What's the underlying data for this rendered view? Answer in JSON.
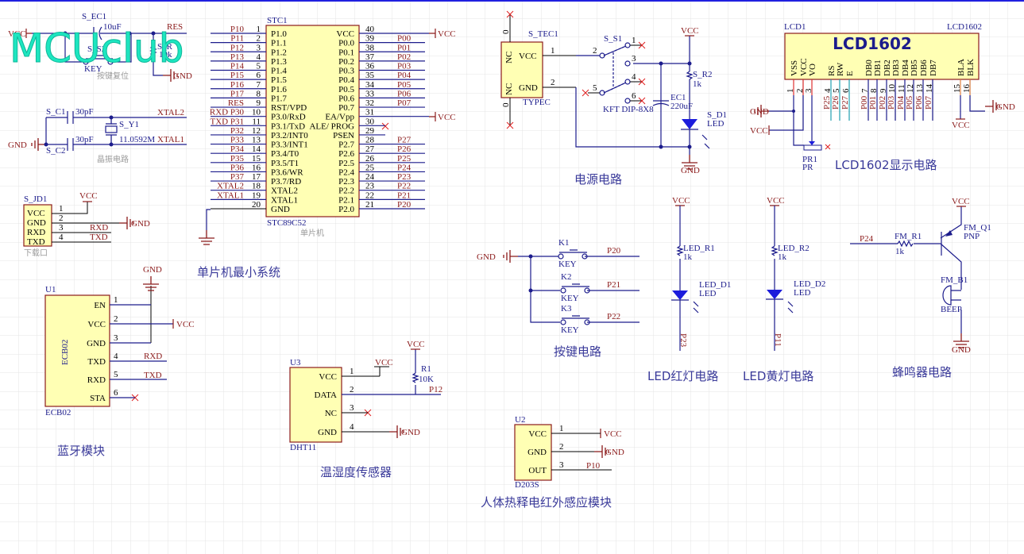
{
  "logo": "MCUclub",
  "nets": {
    "vcc": "VCC",
    "gnd": "GND",
    "res": "RES",
    "xtal1": "XTAL1",
    "xtal2": "XTAL2",
    "rxd": "RXD",
    "txd": "TXD",
    "p10": "P10",
    "p11": "P11",
    "p12": "P12",
    "p20": "P20",
    "p21": "P21",
    "p22": "P22",
    "p23": "P23",
    "p24": "P24"
  },
  "reset": {
    "cap": "S_EC1",
    "cap_value": "10uF",
    "switch": "S_S2",
    "switch_value": "KEY",
    "res": "S_R",
    "res_value": "10k",
    "note": "按键复位"
  },
  "crystal": {
    "c1": "S_C1",
    "c2": "S_C2",
    "c_value": "30pF",
    "xtal": "S_Y1",
    "xtal_value": "11.0592M",
    "note": "晶振电路"
  },
  "header": {
    "ref": "S_JD1",
    "pins": [
      {
        "num": "1",
        "name": "VCC"
      },
      {
        "num": "2",
        "name": "GND"
      },
      {
        "num": "3",
        "name": "RXD"
      },
      {
        "num": "4",
        "name": "TXD"
      }
    ],
    "note": "下载口"
  },
  "mcu": {
    "ref": "STC1",
    "part": "STC89C52",
    "note": "单片机",
    "title": "单片机最小系统",
    "left_pins": [
      {
        "num": "1",
        "name": "P1.0",
        "net": "P10"
      },
      {
        "num": "2",
        "name": "P1.1",
        "net": "P11"
      },
      {
        "num": "3",
        "name": "P1.2",
        "net": "P12"
      },
      {
        "num": "4",
        "name": "P1.3",
        "net": "P13"
      },
      {
        "num": "5",
        "name": "P1.4",
        "net": "P14"
      },
      {
        "num": "6",
        "name": "P1.5",
        "net": "P15"
      },
      {
        "num": "7",
        "name": "P1.6",
        "net": "P16"
      },
      {
        "num": "8",
        "name": "P1.7",
        "net": "P17"
      },
      {
        "num": "9",
        "name": "RST/VPD",
        "net": "RES"
      },
      {
        "num": "10",
        "name": "P3.0/RxD",
        "net": "RXD P30"
      },
      {
        "num": "11",
        "name": "P3.1/TxD",
        "net": "TXD P31"
      },
      {
        "num": "12",
        "name": "P3.2/INT0",
        "net": "P32"
      },
      {
        "num": "13",
        "name": "P3.3/INT1",
        "net": "P33"
      },
      {
        "num": "14",
        "name": "P3.4/T0",
        "net": "P34"
      },
      {
        "num": "15",
        "name": "P3.5/T1",
        "net": "P35"
      },
      {
        "num": "16",
        "name": "P3.6/WR",
        "net": "P36"
      },
      {
        "num": "17",
        "name": "P3.7/RD",
        "net": "P37"
      },
      {
        "num": "18",
        "name": "XTAL2",
        "net": "XTAL2"
      },
      {
        "num": "19",
        "name": "XTAL1",
        "net": "XTAL1"
      },
      {
        "num": "20",
        "name": "GND",
        "net": ""
      }
    ],
    "right_pins": [
      {
        "num": "40",
        "name": "VCC",
        "net": "VCC"
      },
      {
        "num": "39",
        "name": "P0.0",
        "net": "P00"
      },
      {
        "num": "38",
        "name": "P0.1",
        "net": "P01"
      },
      {
        "num": "37",
        "name": "P0.2",
        "net": "P02"
      },
      {
        "num": "36",
        "name": "P0.3",
        "net": "P03"
      },
      {
        "num": "35",
        "name": "P0.4",
        "net": "P04"
      },
      {
        "num": "34",
        "name": "P0.5",
        "net": "P05"
      },
      {
        "num": "33",
        "name": "P0.6",
        "net": "P06"
      },
      {
        "num": "32",
        "name": "P0.7",
        "net": "P07"
      },
      {
        "num": "31",
        "name": "EA/Vpp",
        "net": "VCC"
      },
      {
        "num": "30",
        "name": "ALE/ PROG",
        "net": ""
      },
      {
        "num": "29",
        "name": "PSEN",
        "net": ""
      },
      {
        "num": "28",
        "name": "P2.7",
        "net": "P27"
      },
      {
        "num": "27",
        "name": "P2.6",
        "net": "P26"
      },
      {
        "num": "26",
        "name": "P2.5",
        "net": "P25"
      },
      {
        "num": "25",
        "name": "P2.4",
        "net": "P24"
      },
      {
        "num": "24",
        "name": "P2.3",
        "net": "P23"
      },
      {
        "num": "23",
        "name": "P2.2",
        "net": "P22"
      },
      {
        "num": "22",
        "name": "P2.1",
        "net": "P21"
      },
      {
        "num": "21",
        "name": "P2.0",
        "net": "P20"
      }
    ]
  },
  "bluetooth": {
    "ref": "U1",
    "part": "ECB02",
    "body_label": "ECB02",
    "title": "蓝牙模块",
    "pins": [
      {
        "num": "1",
        "name": "EN"
      },
      {
        "num": "2",
        "name": "VCC"
      },
      {
        "num": "3",
        "name": "GND"
      },
      {
        "num": "4",
        "name": "TXD"
      },
      {
        "num": "5",
        "name": "RXD"
      },
      {
        "num": "6",
        "name": "STA"
      }
    ]
  },
  "dht": {
    "ref": "U3",
    "part": "DHT11",
    "res": "R1",
    "res_value": "10K",
    "title": "温湿度传感器",
    "pins": [
      {
        "num": "1",
        "name": "VCC"
      },
      {
        "num": "2",
        "name": "DATA"
      },
      {
        "num": "3",
        "name": "NC"
      },
      {
        "num": "4",
        "name": "GND"
      }
    ]
  },
  "pir": {
    "ref": "U2",
    "part": "D203S",
    "title": "人体热释电红外感应模块",
    "pins": [
      {
        "num": "1",
        "name": "VCC"
      },
      {
        "num": "2",
        "name": "GND"
      },
      {
        "num": "3",
        "name": "OUT"
      }
    ]
  },
  "power": {
    "ref": "S_TEC1",
    "part": "TYPEC",
    "nc": "NC",
    "zero": "0",
    "p_vcc": "VCC",
    "p_gnd": "GND",
    "pin1": "1",
    "pin2": "2",
    "switch": "S_S1",
    "switch_part": "KFT DIP-8X8",
    "sw_pins": [
      "1",
      "2",
      "3",
      "4",
      "5",
      "6"
    ],
    "cap": "EC1",
    "cap_value": "220uF",
    "res": "S_R2",
    "res_value": "1k",
    "led": "S_D1",
    "led_value": "LED",
    "title": "电源电路"
  },
  "lcd": {
    "ref": "LCD1",
    "part": "LCD1602",
    "body_label": "LCD1602",
    "title": "LCD1602显示电路",
    "pot": "PR1",
    "pot_value": "PR",
    "pins": [
      {
        "num": "1",
        "name": "VSS",
        "net": ""
      },
      {
        "num": "2",
        "name": "VCC",
        "net": ""
      },
      {
        "num": "3",
        "name": "VO",
        "net": ""
      },
      {
        "num": "4",
        "name": "RS",
        "net": "P25"
      },
      {
        "num": "5",
        "name": "RW",
        "net": "P26"
      },
      {
        "num": "6",
        "name": "E",
        "net": "P27"
      },
      {
        "num": "7",
        "name": "DB0",
        "net": "P00"
      },
      {
        "num": "8",
        "name": "DB1",
        "net": "P01"
      },
      {
        "num": "9",
        "name": "DB2",
        "net": "P02"
      },
      {
        "num": "10",
        "name": "DB3",
        "net": "P03"
      },
      {
        "num": "11",
        "name": "DB4",
        "net": "P04"
      },
      {
        "num": "12",
        "name": "DB5",
        "net": "P05"
      },
      {
        "num": "13",
        "name": "DB6",
        "net": "P06"
      },
      {
        "num": "14",
        "name": "DB7",
        "net": "P07"
      },
      {
        "num": "15",
        "name": "BLA",
        "net": ""
      },
      {
        "num": "16",
        "name": "BLK",
        "net": ""
      }
    ]
  },
  "keys": {
    "title": "按键电路",
    "items": [
      {
        "ref": "K1",
        "value": "KEY",
        "net": "P20"
      },
      {
        "ref": "K2",
        "value": "KEY",
        "net": "P21"
      },
      {
        "ref": "K3",
        "value": "KEY",
        "net": "P22"
      }
    ]
  },
  "led_red": {
    "res": "LED_R1",
    "res_value": "1k",
    "led": "LED_D1",
    "led_value": "LED",
    "net": "P23",
    "title": "LED红灯电路"
  },
  "led_yellow": {
    "res": "LED_R2",
    "res_value": "1k",
    "led": "LED_D2",
    "led_value": "LED",
    "net": "P11",
    "title": "LED黄灯电路"
  },
  "buzzer": {
    "res": "FM_R1",
    "res_value": "1k",
    "transistor": "FM_Q1",
    "transistor_type": "PNP",
    "buzzer": "FM_B1",
    "buzzer_value": "BEEP",
    "net": "P24",
    "title": "蜂鸣器电路"
  },
  "colors": {
    "wire": "#1c1c8c",
    "net_label": "#8b1a1a",
    "component_fill": "#ffffb4",
    "logo": "#1de6c0",
    "grid": "#e4e4e4"
  }
}
